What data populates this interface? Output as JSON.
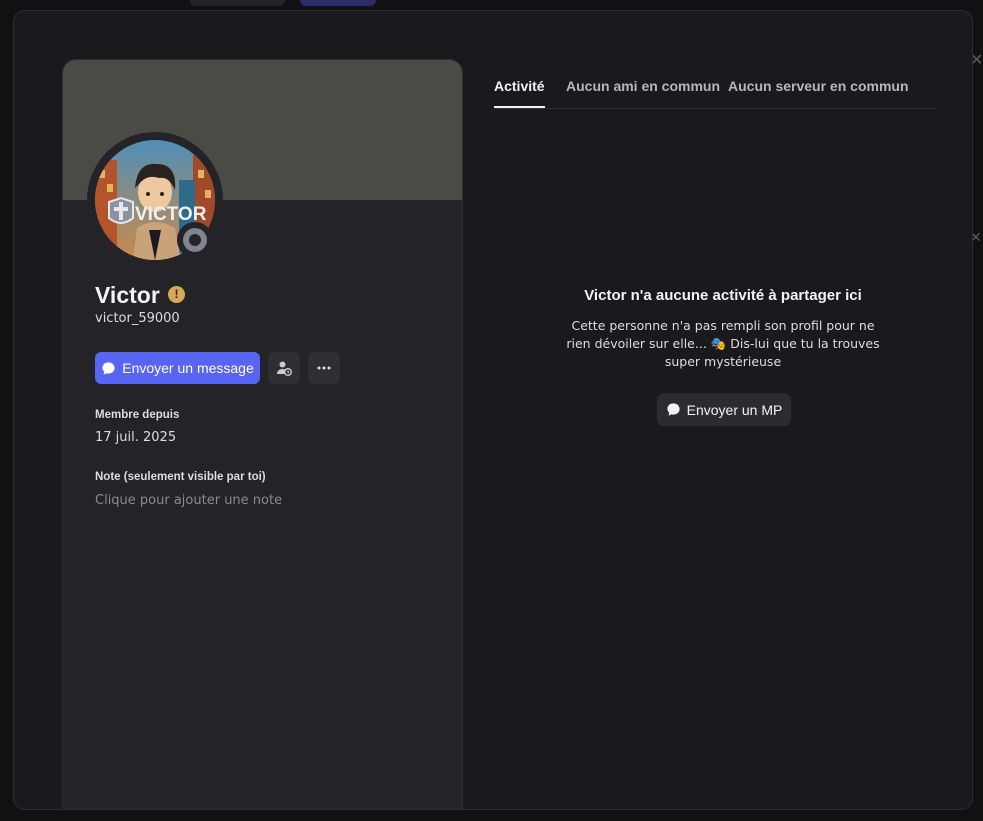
{
  "profile": {
    "display_name": "Victor",
    "username": "victor_59000",
    "avatar_text": "VICTOR",
    "warning_badge": "!",
    "status": "offline",
    "banner_color": "#4a4b45"
  },
  "actions": {
    "send_message_label": "Envoyer un message",
    "add_friend_icon": "add-friend-icon",
    "more_icon": "more-icon"
  },
  "member_since": {
    "label": "Membre depuis",
    "value": "17 juil. 2025"
  },
  "note": {
    "label": "Note (seulement visible par toi)",
    "placeholder": "Clique pour ajouter une note"
  },
  "tabs": [
    {
      "label": "Activité",
      "active": true
    },
    {
      "label": "Aucun ami en commun",
      "active": false
    },
    {
      "label": "Aucun serveur en commun",
      "active": false
    }
  ],
  "activity": {
    "empty_title": "Victor n'a aucune activité à partager ici",
    "empty_text": "Cette personne n'a pas rempli son profil pour ne rien dévoiler sur elle... 🎭 Dis-lui que tu la trouves super mystérieuse",
    "dm_button_label": "Envoyer un MP"
  },
  "colors": {
    "accent": "#5865f2",
    "warning": "#d8a858",
    "status_offline": "#80848e"
  }
}
